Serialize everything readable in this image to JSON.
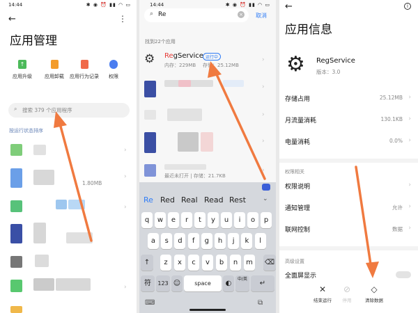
{
  "status": {
    "time1": "14:44",
    "time2": "14:44",
    "icons": "✱ ◉ ⏰ ▮▮ ◠ ▭"
  },
  "p1": {
    "title": "应用管理",
    "tools": [
      {
        "label": "应用升级",
        "icon": "upgrade-icon",
        "color": "#4cba5a"
      },
      {
        "label": "应用卸载",
        "icon": "trash-icon",
        "color": "#f39c2b"
      },
      {
        "label": "应用行为记录",
        "icon": "record-icon",
        "color": "#f06a4a"
      },
      {
        "label": "权限",
        "icon": "shield-icon",
        "color": "#4a7df0"
      }
    ],
    "search_placeholder": "搜索 379 个应用程序",
    "sort_label": "按运行状态排序",
    "row_sizes": [
      "",
      "1.80MB",
      "",
      "",
      "",
      "",
      ""
    ]
  },
  "p2": {
    "search_value": "Re",
    "cancel": "取消",
    "found": "找到22个应用",
    "result": {
      "name": "RegService",
      "badge": "运行中",
      "memory": "内存：229MB",
      "storage": "存储：25.12MB"
    },
    "blur_rows": [
      {
        "line": ""
      },
      {
        "line": ""
      },
      {
        "line": ""
      },
      {
        "line": ""
      },
      {
        "line": "最近未打开 | 存储：21.7KB"
      }
    ],
    "suggestions": [
      "Re",
      "Red",
      "Real",
      "Read",
      "Rest"
    ],
    "keys_row1": [
      "q",
      "w",
      "e",
      "r",
      "t",
      "y",
      "u",
      "i",
      "o",
      "p"
    ],
    "keys_row2": [
      "a",
      "s",
      "d",
      "f",
      "g",
      "h",
      "j",
      "k",
      "l"
    ],
    "keys_row3": [
      "z",
      "x",
      "c",
      "v",
      "b",
      "n",
      "m"
    ],
    "key_fu": "符",
    "key_123": "123",
    "key_space": "space",
    "key_lang": "中/英"
  },
  "p3": {
    "title": "应用信息",
    "app_name": "RegService",
    "version": "版本：3.0",
    "items": [
      {
        "label": "存储占用",
        "value": "25.12MB"
      },
      {
        "label": "月流量消耗",
        "value": "130.1KB"
      },
      {
        "label": "电量消耗",
        "value": "0.0%"
      }
    ],
    "section1": "权限相关",
    "perm_items": [
      {
        "label": "权限说明",
        "value": ""
      },
      {
        "label": "通知管理",
        "value": "允许"
      },
      {
        "label": "联网控制",
        "value": "数据"
      }
    ],
    "section2": "高级设置",
    "fullscreen": "全面屏显示",
    "actions": [
      {
        "label": "结束运行",
        "icon": "close-icon"
      },
      {
        "label": "停用",
        "icon": "disable-icon"
      },
      {
        "label": "清除数据",
        "icon": "eraser-icon"
      }
    ]
  },
  "colors": {
    "accent": "#2f7cf6",
    "arrow": "#f07a40",
    "badge": "#2f7cf6",
    "match": "#e53935"
  }
}
